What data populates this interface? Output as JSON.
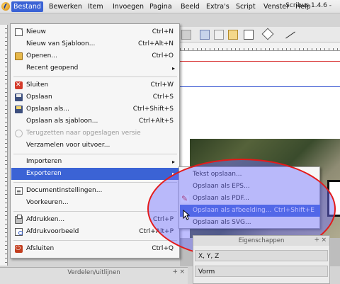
{
  "window": {
    "title": "Scribus 1.4.6 -"
  },
  "menubar": {
    "items": [
      "Bestand",
      "Bewerken",
      "Item",
      "Invoegen",
      "Pagina",
      "Beeld",
      "Extra's",
      "Script",
      "Venster",
      "Help"
    ],
    "active": "Bestand"
  },
  "file_menu": {
    "new": {
      "label": "Nieuw",
      "shortcut": "Ctrl+N"
    },
    "new_from_template": {
      "label": "Nieuw van Sjabloon...",
      "shortcut": "Ctrl+Alt+N"
    },
    "open": {
      "label": "Openen...",
      "shortcut": "Ctrl+O"
    },
    "recent": {
      "label": "Recent geopend"
    },
    "close": {
      "label": "Sluiten",
      "shortcut": "Ctrl+W"
    },
    "save": {
      "label": "Opslaan",
      "shortcut": "Ctrl+S"
    },
    "save_as": {
      "label": "Opslaan als...",
      "shortcut": "Ctrl+Shift+S"
    },
    "save_as_template": {
      "label": "Opslaan als sjabloon...",
      "shortcut": "Ctrl+Alt+S"
    },
    "revert": {
      "label": "Terugzetten naar opgeslagen versie"
    },
    "collect": {
      "label": "Verzamelen voor uitvoer..."
    },
    "import": {
      "label": "Importeren"
    },
    "export": {
      "label": "Exporteren"
    },
    "doc_settings": {
      "label": "Documentinstellingen..."
    },
    "preferences": {
      "label": "Voorkeuren..."
    },
    "print": {
      "label": "Afdrukken...",
      "shortcut": "Ctrl+P"
    },
    "print_preview": {
      "label": "Afdrukvoorbeeld",
      "shortcut": "Ctrl+Alt+P"
    },
    "quit": {
      "label": "Afsluiten",
      "shortcut": "Ctrl+Q"
    }
  },
  "export_submenu": {
    "text": {
      "label": "Tekst opslaan..."
    },
    "eps": {
      "label": "Opslaan als EPS..."
    },
    "pdf": {
      "label": "Opslaan als PDF..."
    },
    "image": {
      "label": "Opslaan als afbeelding...",
      "shortcut": "Ctrl+Shift+E"
    },
    "svg": {
      "label": "Opslaan als SVG..."
    }
  },
  "properties_panel": {
    "title": "Eigenschappen",
    "rows": [
      "X, Y, Z",
      "Vorm"
    ]
  },
  "align_panel": {
    "title": "Verdelen/uitlijnen"
  },
  "colors": {
    "highlight": "#3b63d5",
    "annotation_ring": "#e41a1a",
    "annotation_fill": "#6e6eff"
  }
}
